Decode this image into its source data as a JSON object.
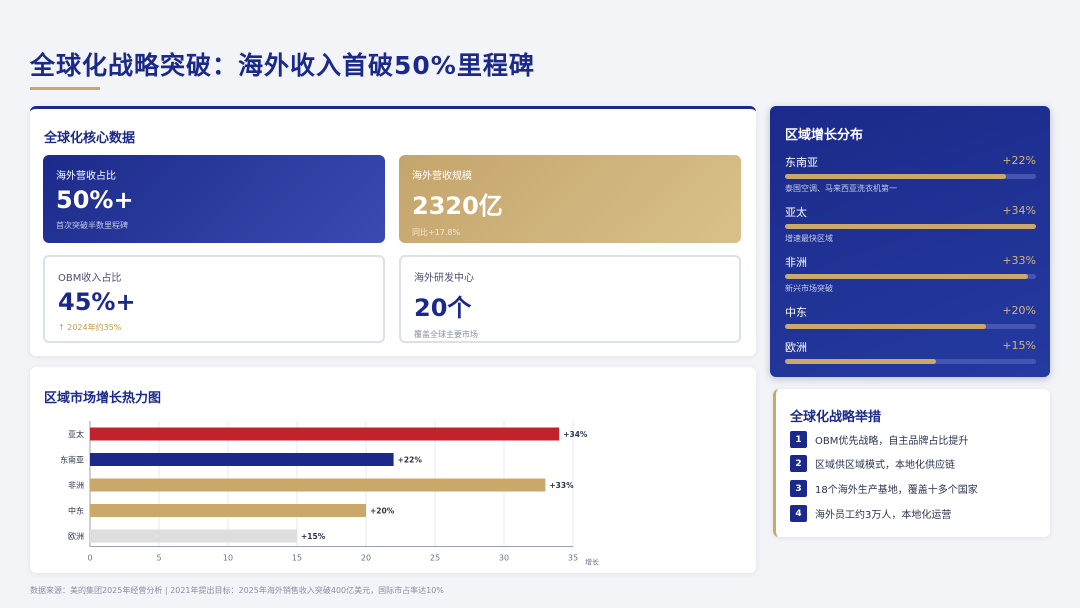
{
  "title": "全球化战略突破：海外收入首破50%里程碑",
  "core": {
    "title": "全球化核心数据",
    "kpis": [
      {
        "label": "海外营收占比",
        "value": "50%+",
        "note": "首次突破半数里程碑"
      },
      {
        "label": "海外营收规模",
        "value": "2320亿",
        "note": "同比+17.8%"
      },
      {
        "label": "OBM收入占比",
        "value": "45%+",
        "note": "↑ 2024年约35%"
      },
      {
        "label": "海外研发中心",
        "value": "20个",
        "note": "覆盖全球主要市场"
      }
    ]
  },
  "heatmap": {
    "title": "区域市场增长热力图",
    "x_unit": "增长"
  },
  "chart_data": {
    "type": "bar",
    "orientation": "horizontal",
    "categories": [
      "亚太",
      "东南亚",
      "非洲",
      "中东",
      "欧洲"
    ],
    "values": [
      34,
      22,
      33,
      20,
      15
    ],
    "data_labels": [
      "+34%",
      "+22%",
      "+33%",
      "+20%",
      "+15%"
    ],
    "colors": [
      "#c0232b",
      "#1b2a8a",
      "#c9a86a",
      "#c9a86a",
      "#dedede"
    ],
    "xlim": [
      0,
      35
    ],
    "xticks": [
      0,
      5,
      10,
      15,
      20,
      25,
      30,
      35
    ],
    "grid": true
  },
  "regions": {
    "title": "区域增长分布",
    "items": [
      {
        "name": "东南亚",
        "pct": "+22%",
        "fill": 0.88,
        "note": "泰国空调、马来西亚洗衣机第一"
      },
      {
        "name": "亚太",
        "pct": "+34%",
        "fill": 1.0,
        "note": "增速最快区域"
      },
      {
        "name": "非洲",
        "pct": "+33%",
        "fill": 0.97,
        "note": "新兴市场突破"
      },
      {
        "name": "中东",
        "pct": "+20%",
        "fill": 0.8,
        "note": ""
      },
      {
        "name": "欧洲",
        "pct": "+15%",
        "fill": 0.6,
        "note": ""
      }
    ]
  },
  "strategy": {
    "title": "全球化战略举措",
    "items": [
      {
        "num": "1",
        "text": "OBM优先战略，自主品牌占比提升"
      },
      {
        "num": "2",
        "text": "区域供区域模式，本地化供应链"
      },
      {
        "num": "3",
        "text": "18个海外生产基地，覆盖十多个国家"
      },
      {
        "num": "4",
        "text": "海外员工约3万人，本地化运营"
      }
    ]
  },
  "source": "数据来源：美的集团2025年经营分析 | 2021年提出目标：2025年海外销售收入突破400亿美元，国际市占率达10%"
}
